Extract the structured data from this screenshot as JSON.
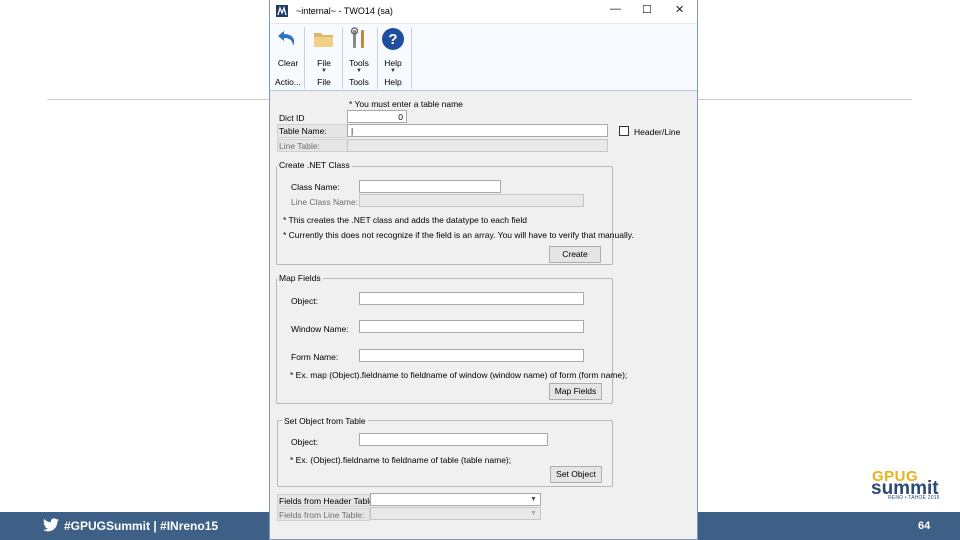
{
  "footer": {
    "hashtags": "#GPUGSummit | #INreno15",
    "page_number": "64",
    "brand_line1": "GPUG",
    "brand_line2": "summit",
    "brand_line3": "RENO • TAHOE 2015"
  },
  "window": {
    "title": "~internal~  -  TWO14 (sa)",
    "controls": {
      "minimize": "—",
      "maximize": "☐",
      "close": "✕"
    }
  },
  "ribbon": {
    "buttons": [
      {
        "label": "Clear",
        "icon": "clear-arrow-icon"
      },
      {
        "label": "File",
        "icon": "folder-icon"
      },
      {
        "label": "Tools",
        "icon": "tools-icon"
      },
      {
        "label": "Help",
        "icon": "help-icon"
      }
    ],
    "groups": [
      "Actio...",
      "File",
      "Tools",
      "Help"
    ]
  },
  "form": {
    "warning": "* You must enter a table name",
    "dict_id_label": "Dict ID",
    "dict_id_value": "0",
    "table_name_label": "Table Name:",
    "table_name_value": "|",
    "line_table_label": "Line Table:",
    "header_line_label": "Header/Line",
    "net_group": {
      "title": "Create .NET Class",
      "class_name_label": "Class Name:",
      "line_class_name_label": "Line Class Name:",
      "note1": "* This creates the .NET class and adds the datatype to each field",
      "note2": "* Currently this does not recognize if the field is an array. You will have to verify that manually.",
      "create_button": "Create"
    },
    "map_group": {
      "title": "Map Fields",
      "object_label": "Object:",
      "window_name_label": "Window Name:",
      "form_name_label": "Form Name:",
      "note": "* Ex. map (Object).fieldname to fieldname of window (window name) of form (form name);",
      "map_button": "Map Fields"
    },
    "set_group": {
      "title": "Set Object from Table",
      "object_label": "Object:",
      "note": "* Ex. (Object).fieldname to fieldname of table (table  name);",
      "set_button": "Set Object"
    },
    "fields_header_label": "Fields from Header Table:",
    "fields_line_label": "Fields from Line Table:"
  }
}
